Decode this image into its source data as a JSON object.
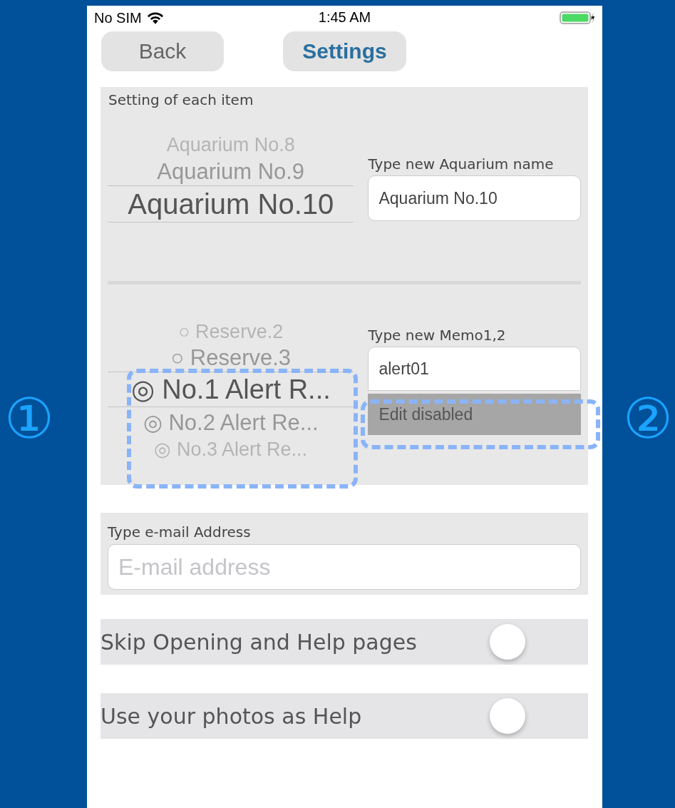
{
  "status_bar": {
    "carrier": "No SIM",
    "time": "1:45 AM"
  },
  "nav": {
    "back": "Back",
    "title": "Settings"
  },
  "item_settings": {
    "title": "Setting of each item",
    "aquarium_picker": [
      {
        "label": "Aquarium No.8",
        "selected": false
      },
      {
        "label": "Aquarium No.9",
        "selected": false
      },
      {
        "label": "Aquarium No.10",
        "selected": true
      }
    ],
    "name_label": "Type new Aquarium name",
    "name_value": "Aquarium No.10",
    "memo_picker": [
      {
        "label": "○ Reserve.2",
        "selected": false
      },
      {
        "label": "○ Reserve.3",
        "selected": false
      },
      {
        "label": "◎ No.1 Alert R...",
        "selected": true
      },
      {
        "label": "◎ No.2 Alert Re...",
        "selected": false
      },
      {
        "label": "◎ No.3 Alert Re...",
        "selected": false
      }
    ],
    "memo_label": "Type new Memo1,2",
    "memo_value": "alert01",
    "memo2_value": "Edit disabled",
    "memo2_disabled": true
  },
  "email": {
    "label": "Type e-mail Address",
    "placeholder": "E-mail address"
  },
  "toggles": [
    {
      "label": "Skip Opening and Help pages",
      "on": false
    },
    {
      "label": "Use your photos as Help",
      "on": false
    }
  ],
  "annotations": [
    "①",
    "②"
  ]
}
